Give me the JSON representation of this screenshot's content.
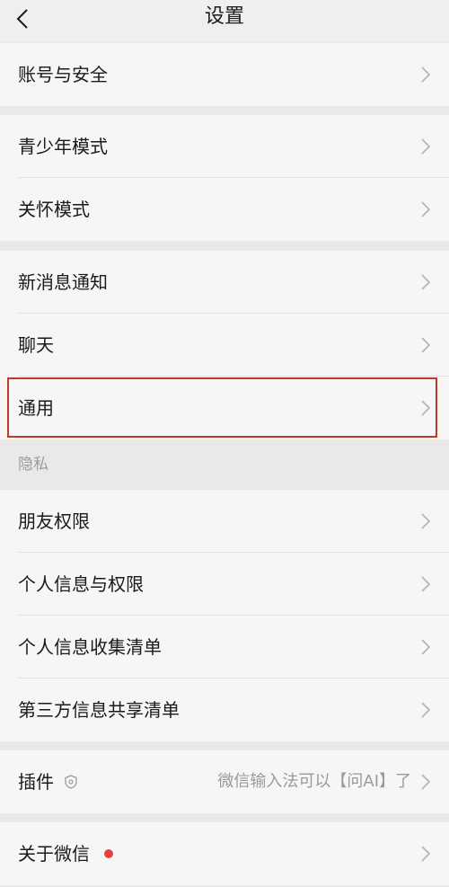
{
  "header": {
    "title": "设置"
  },
  "rows": {
    "account_security": "账号与安全",
    "teen_mode": "青少年模式",
    "care_mode": "关怀模式",
    "new_message_notify": "新消息通知",
    "chat": "聊天",
    "general": "通用",
    "friend_permissions": "朋友权限",
    "personal_info_permissions": "个人信息与权限",
    "personal_info_collection": "个人信息收集清单",
    "third_party_sharing": "第三方信息共享清单",
    "plugins": "插件",
    "plugins_value": "微信输入法可以【问AI】了",
    "about": "关于微信"
  },
  "sections": {
    "privacy": "隐私"
  },
  "colors": {
    "highlight_border": "#c0392b",
    "notification_dot": "#e64340"
  },
  "icons": {
    "back": "chevron-left-icon",
    "row_arrow": "chevron-right-icon",
    "plugin": "shield-icon"
  }
}
